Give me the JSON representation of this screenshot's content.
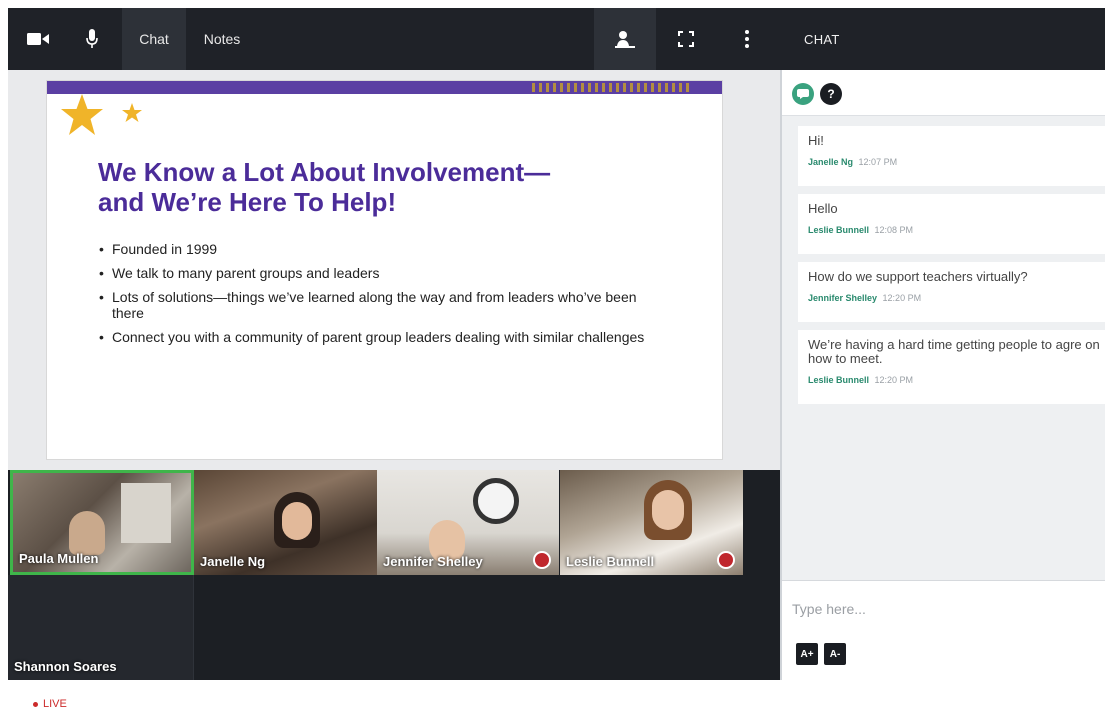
{
  "toolbar": {
    "chat_tab": "Chat",
    "notes_tab": "Notes",
    "icons": [
      "video-camera-icon",
      "microphone-icon",
      "raise-hand-icon",
      "fullscreen-icon",
      "more-vertical-icon"
    ]
  },
  "slide": {
    "title_line1": "We Know a Lot About Involvement—",
    "title_line2": "and We’re Here To Help!",
    "bullets": [
      "Founded in 1999",
      "We talk to many parent groups and leaders",
      "Lots of solutions—things we’ve learned along the way and from leaders who’ve been there",
      "Connect you with a community of parent group leaders dealing with similar challenges"
    ],
    "colors": {
      "title": "#4b2c99",
      "band": "#5b3fa3",
      "star": "#f0b429"
    }
  },
  "participants": [
    {
      "name": "Paula Mullen",
      "speaking": true,
      "muted": false
    },
    {
      "name": "Janelle Ng",
      "speaking": false,
      "muted": false
    },
    {
      "name": "Jennifer Shelley",
      "speaking": false,
      "muted": true
    },
    {
      "name": "Leslie Bunnell",
      "speaking": false,
      "muted": true
    },
    {
      "name": "Shannon Soares",
      "speaking": false,
      "muted": false
    }
  ],
  "chat": {
    "title": "CHAT",
    "messages": [
      {
        "text": "Hi!",
        "author": "Janelle Ng",
        "time": "12:07 PM"
      },
      {
        "text": "Hello",
        "author": "Leslie Bunnell",
        "time": "12:08 PM"
      },
      {
        "text": "How do we support teachers virtually?",
        "author": "Jennifer Shelley",
        "time": "12:20 PM"
      },
      {
        "text": "We’re having a hard time getting people to agre on how to meet.",
        "author": "Leslie Bunnell",
        "time": "12:20 PM"
      }
    ],
    "input_placeholder": "Type here...",
    "font_increase": "A+",
    "font_decrease": "A-",
    "help_label": "?",
    "colors": {
      "author": "#2a8a6e",
      "emoji_button": "#3aa27f"
    }
  },
  "status": {
    "live_label": "LIVE",
    "color": "#cc2b2b"
  }
}
